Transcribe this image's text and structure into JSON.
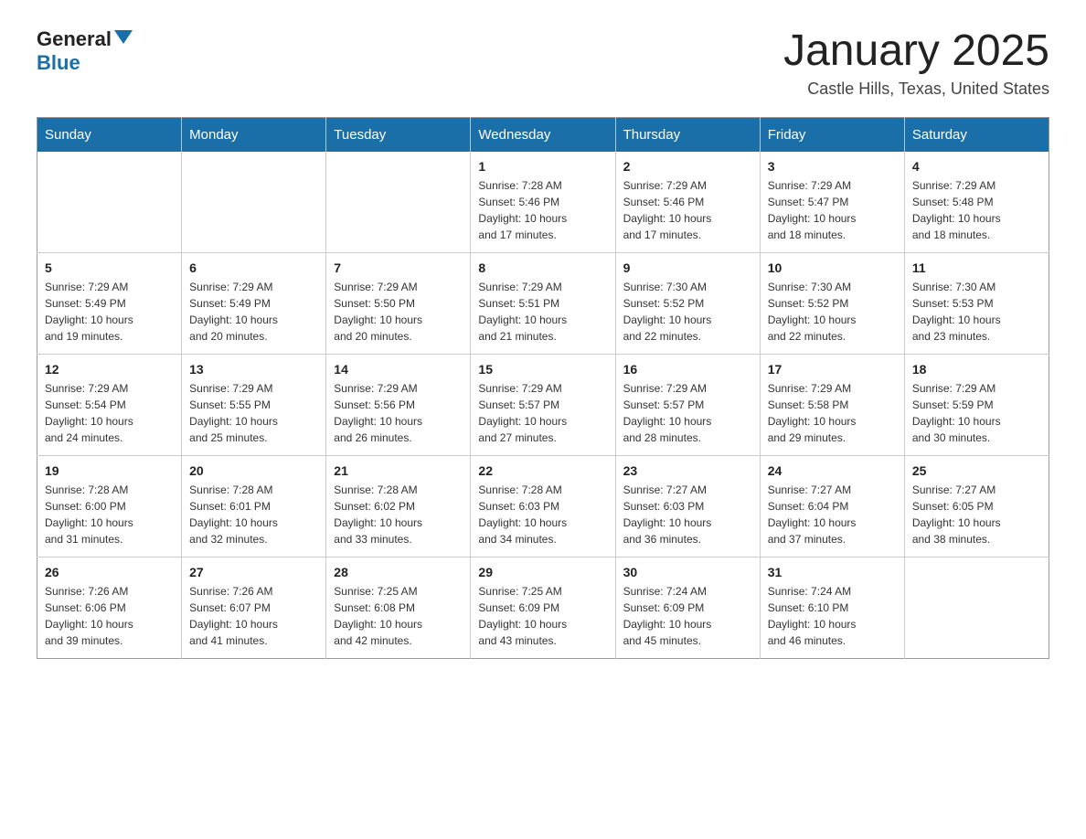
{
  "header": {
    "logo_general": "General",
    "logo_blue": "Blue",
    "month_title": "January 2025",
    "location": "Castle Hills, Texas, United States"
  },
  "days_of_week": [
    "Sunday",
    "Monday",
    "Tuesday",
    "Wednesday",
    "Thursday",
    "Friday",
    "Saturday"
  ],
  "weeks": [
    [
      {
        "day": "",
        "info": ""
      },
      {
        "day": "",
        "info": ""
      },
      {
        "day": "",
        "info": ""
      },
      {
        "day": "1",
        "info": "Sunrise: 7:28 AM\nSunset: 5:46 PM\nDaylight: 10 hours\nand 17 minutes."
      },
      {
        "day": "2",
        "info": "Sunrise: 7:29 AM\nSunset: 5:46 PM\nDaylight: 10 hours\nand 17 minutes."
      },
      {
        "day": "3",
        "info": "Sunrise: 7:29 AM\nSunset: 5:47 PM\nDaylight: 10 hours\nand 18 minutes."
      },
      {
        "day": "4",
        "info": "Sunrise: 7:29 AM\nSunset: 5:48 PM\nDaylight: 10 hours\nand 18 minutes."
      }
    ],
    [
      {
        "day": "5",
        "info": "Sunrise: 7:29 AM\nSunset: 5:49 PM\nDaylight: 10 hours\nand 19 minutes."
      },
      {
        "day": "6",
        "info": "Sunrise: 7:29 AM\nSunset: 5:49 PM\nDaylight: 10 hours\nand 20 minutes."
      },
      {
        "day": "7",
        "info": "Sunrise: 7:29 AM\nSunset: 5:50 PM\nDaylight: 10 hours\nand 20 minutes."
      },
      {
        "day": "8",
        "info": "Sunrise: 7:29 AM\nSunset: 5:51 PM\nDaylight: 10 hours\nand 21 minutes."
      },
      {
        "day": "9",
        "info": "Sunrise: 7:30 AM\nSunset: 5:52 PM\nDaylight: 10 hours\nand 22 minutes."
      },
      {
        "day": "10",
        "info": "Sunrise: 7:30 AM\nSunset: 5:52 PM\nDaylight: 10 hours\nand 22 minutes."
      },
      {
        "day": "11",
        "info": "Sunrise: 7:30 AM\nSunset: 5:53 PM\nDaylight: 10 hours\nand 23 minutes."
      }
    ],
    [
      {
        "day": "12",
        "info": "Sunrise: 7:29 AM\nSunset: 5:54 PM\nDaylight: 10 hours\nand 24 minutes."
      },
      {
        "day": "13",
        "info": "Sunrise: 7:29 AM\nSunset: 5:55 PM\nDaylight: 10 hours\nand 25 minutes."
      },
      {
        "day": "14",
        "info": "Sunrise: 7:29 AM\nSunset: 5:56 PM\nDaylight: 10 hours\nand 26 minutes."
      },
      {
        "day": "15",
        "info": "Sunrise: 7:29 AM\nSunset: 5:57 PM\nDaylight: 10 hours\nand 27 minutes."
      },
      {
        "day": "16",
        "info": "Sunrise: 7:29 AM\nSunset: 5:57 PM\nDaylight: 10 hours\nand 28 minutes."
      },
      {
        "day": "17",
        "info": "Sunrise: 7:29 AM\nSunset: 5:58 PM\nDaylight: 10 hours\nand 29 minutes."
      },
      {
        "day": "18",
        "info": "Sunrise: 7:29 AM\nSunset: 5:59 PM\nDaylight: 10 hours\nand 30 minutes."
      }
    ],
    [
      {
        "day": "19",
        "info": "Sunrise: 7:28 AM\nSunset: 6:00 PM\nDaylight: 10 hours\nand 31 minutes."
      },
      {
        "day": "20",
        "info": "Sunrise: 7:28 AM\nSunset: 6:01 PM\nDaylight: 10 hours\nand 32 minutes."
      },
      {
        "day": "21",
        "info": "Sunrise: 7:28 AM\nSunset: 6:02 PM\nDaylight: 10 hours\nand 33 minutes."
      },
      {
        "day": "22",
        "info": "Sunrise: 7:28 AM\nSunset: 6:03 PM\nDaylight: 10 hours\nand 34 minutes."
      },
      {
        "day": "23",
        "info": "Sunrise: 7:27 AM\nSunset: 6:03 PM\nDaylight: 10 hours\nand 36 minutes."
      },
      {
        "day": "24",
        "info": "Sunrise: 7:27 AM\nSunset: 6:04 PM\nDaylight: 10 hours\nand 37 minutes."
      },
      {
        "day": "25",
        "info": "Sunrise: 7:27 AM\nSunset: 6:05 PM\nDaylight: 10 hours\nand 38 minutes."
      }
    ],
    [
      {
        "day": "26",
        "info": "Sunrise: 7:26 AM\nSunset: 6:06 PM\nDaylight: 10 hours\nand 39 minutes."
      },
      {
        "day": "27",
        "info": "Sunrise: 7:26 AM\nSunset: 6:07 PM\nDaylight: 10 hours\nand 41 minutes."
      },
      {
        "day": "28",
        "info": "Sunrise: 7:25 AM\nSunset: 6:08 PM\nDaylight: 10 hours\nand 42 minutes."
      },
      {
        "day": "29",
        "info": "Sunrise: 7:25 AM\nSunset: 6:09 PM\nDaylight: 10 hours\nand 43 minutes."
      },
      {
        "day": "30",
        "info": "Sunrise: 7:24 AM\nSunset: 6:09 PM\nDaylight: 10 hours\nand 45 minutes."
      },
      {
        "day": "31",
        "info": "Sunrise: 7:24 AM\nSunset: 6:10 PM\nDaylight: 10 hours\nand 46 minutes."
      },
      {
        "day": "",
        "info": ""
      }
    ]
  ]
}
